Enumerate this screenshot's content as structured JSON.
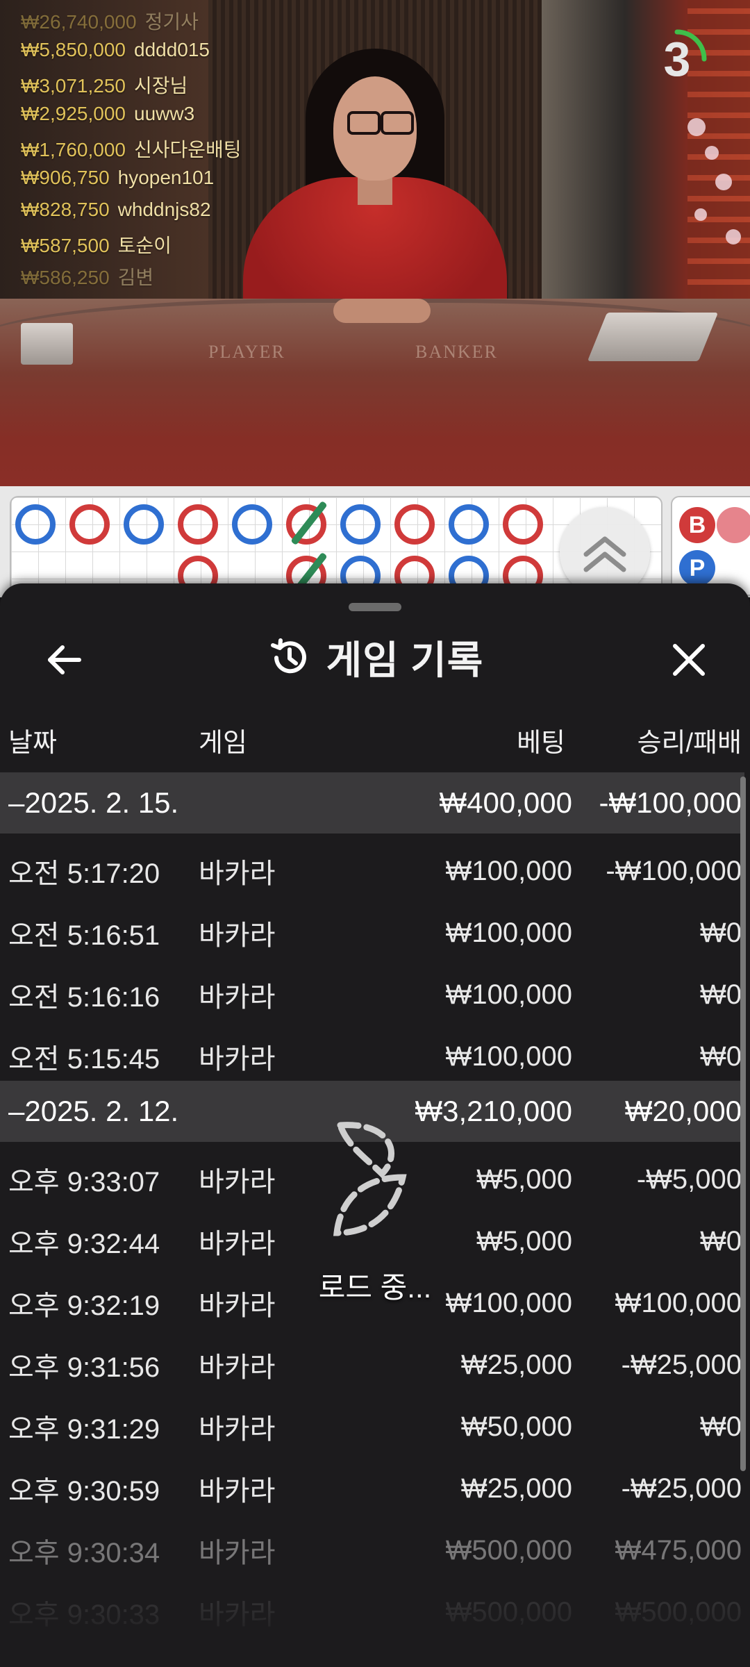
{
  "countdown": "3",
  "chat_feed": [
    {
      "amount": "₩26,740,000",
      "user": "정기사"
    },
    {
      "amount": "₩5,850,000",
      "user": "dddd015"
    },
    {
      "amount": "₩3,071,250",
      "user": "시장님"
    },
    {
      "amount": "₩2,925,000",
      "user": "uuww3"
    },
    {
      "amount": "₩1,760,000",
      "user": "신사다운배팅"
    },
    {
      "amount": "₩906,750",
      "user": "hyopen101"
    },
    {
      "amount": "₩828,750",
      "user": "whddnjs82"
    },
    {
      "amount": "₩587,500",
      "user": "토순이"
    },
    {
      "amount": "₩586,250",
      "user": "김변"
    }
  ],
  "table_labels": {
    "player": "PLAYER",
    "banker": "BANKER"
  },
  "side_beads": [
    "B",
    "P"
  ],
  "history": {
    "title": "게임 기록",
    "columns": {
      "date": "날짜",
      "game": "게임",
      "bet": "베팅",
      "win_loss": "승리/패배"
    },
    "groups": [
      {
        "date": "–2025. 2. 15.",
        "bet": "₩400,000",
        "result": "-₩100,000",
        "rows": [
          {
            "time": "오전 5:17:20",
            "game": "바카라",
            "bet": "₩100,000",
            "result": "-₩100,000"
          },
          {
            "time": "오전 5:16:51",
            "game": "바카라",
            "bet": "₩100,000",
            "result": "₩0"
          },
          {
            "time": "오전 5:16:16",
            "game": "바카라",
            "bet": "₩100,000",
            "result": "₩0"
          },
          {
            "time": "오전 5:15:45",
            "game": "바카라",
            "bet": "₩100,000",
            "result": "₩0"
          }
        ]
      },
      {
        "date": "–2025. 2. 12.",
        "bet": "₩3,210,000",
        "result": "₩20,000",
        "rows": [
          {
            "time": "오후 9:33:07",
            "game": "바카라",
            "bet": "₩5,000",
            "result": "-₩5,000"
          },
          {
            "time": "오후 9:32:44",
            "game": "바카라",
            "bet": "₩5,000",
            "result": "₩0"
          },
          {
            "time": "오후 9:32:19",
            "game": "바카라",
            "bet": "₩100,000",
            "result": "₩100,000"
          },
          {
            "time": "오후 9:31:56",
            "game": "바카라",
            "bet": "₩25,000",
            "result": "-₩25,000"
          },
          {
            "time": "오후 9:31:29",
            "game": "바카라",
            "bet": "₩50,000",
            "result": "₩0"
          },
          {
            "time": "오후 9:30:59",
            "game": "바카라",
            "bet": "₩25,000",
            "result": "-₩25,000"
          },
          {
            "time": "오후 9:30:34",
            "game": "바카라",
            "bet": "₩500,000",
            "result": "₩475,000"
          },
          {
            "time": "오후 9:30:33",
            "game": "바카라",
            "bet": "₩500,000",
            "result": "₩500,000"
          }
        ]
      }
    ]
  },
  "loading_text": "로드 중...",
  "colors": {
    "player": "#2f6fd1",
    "banker": "#d03a3a",
    "tie": "#2e8b57",
    "sheet": "#1c1b1d"
  }
}
